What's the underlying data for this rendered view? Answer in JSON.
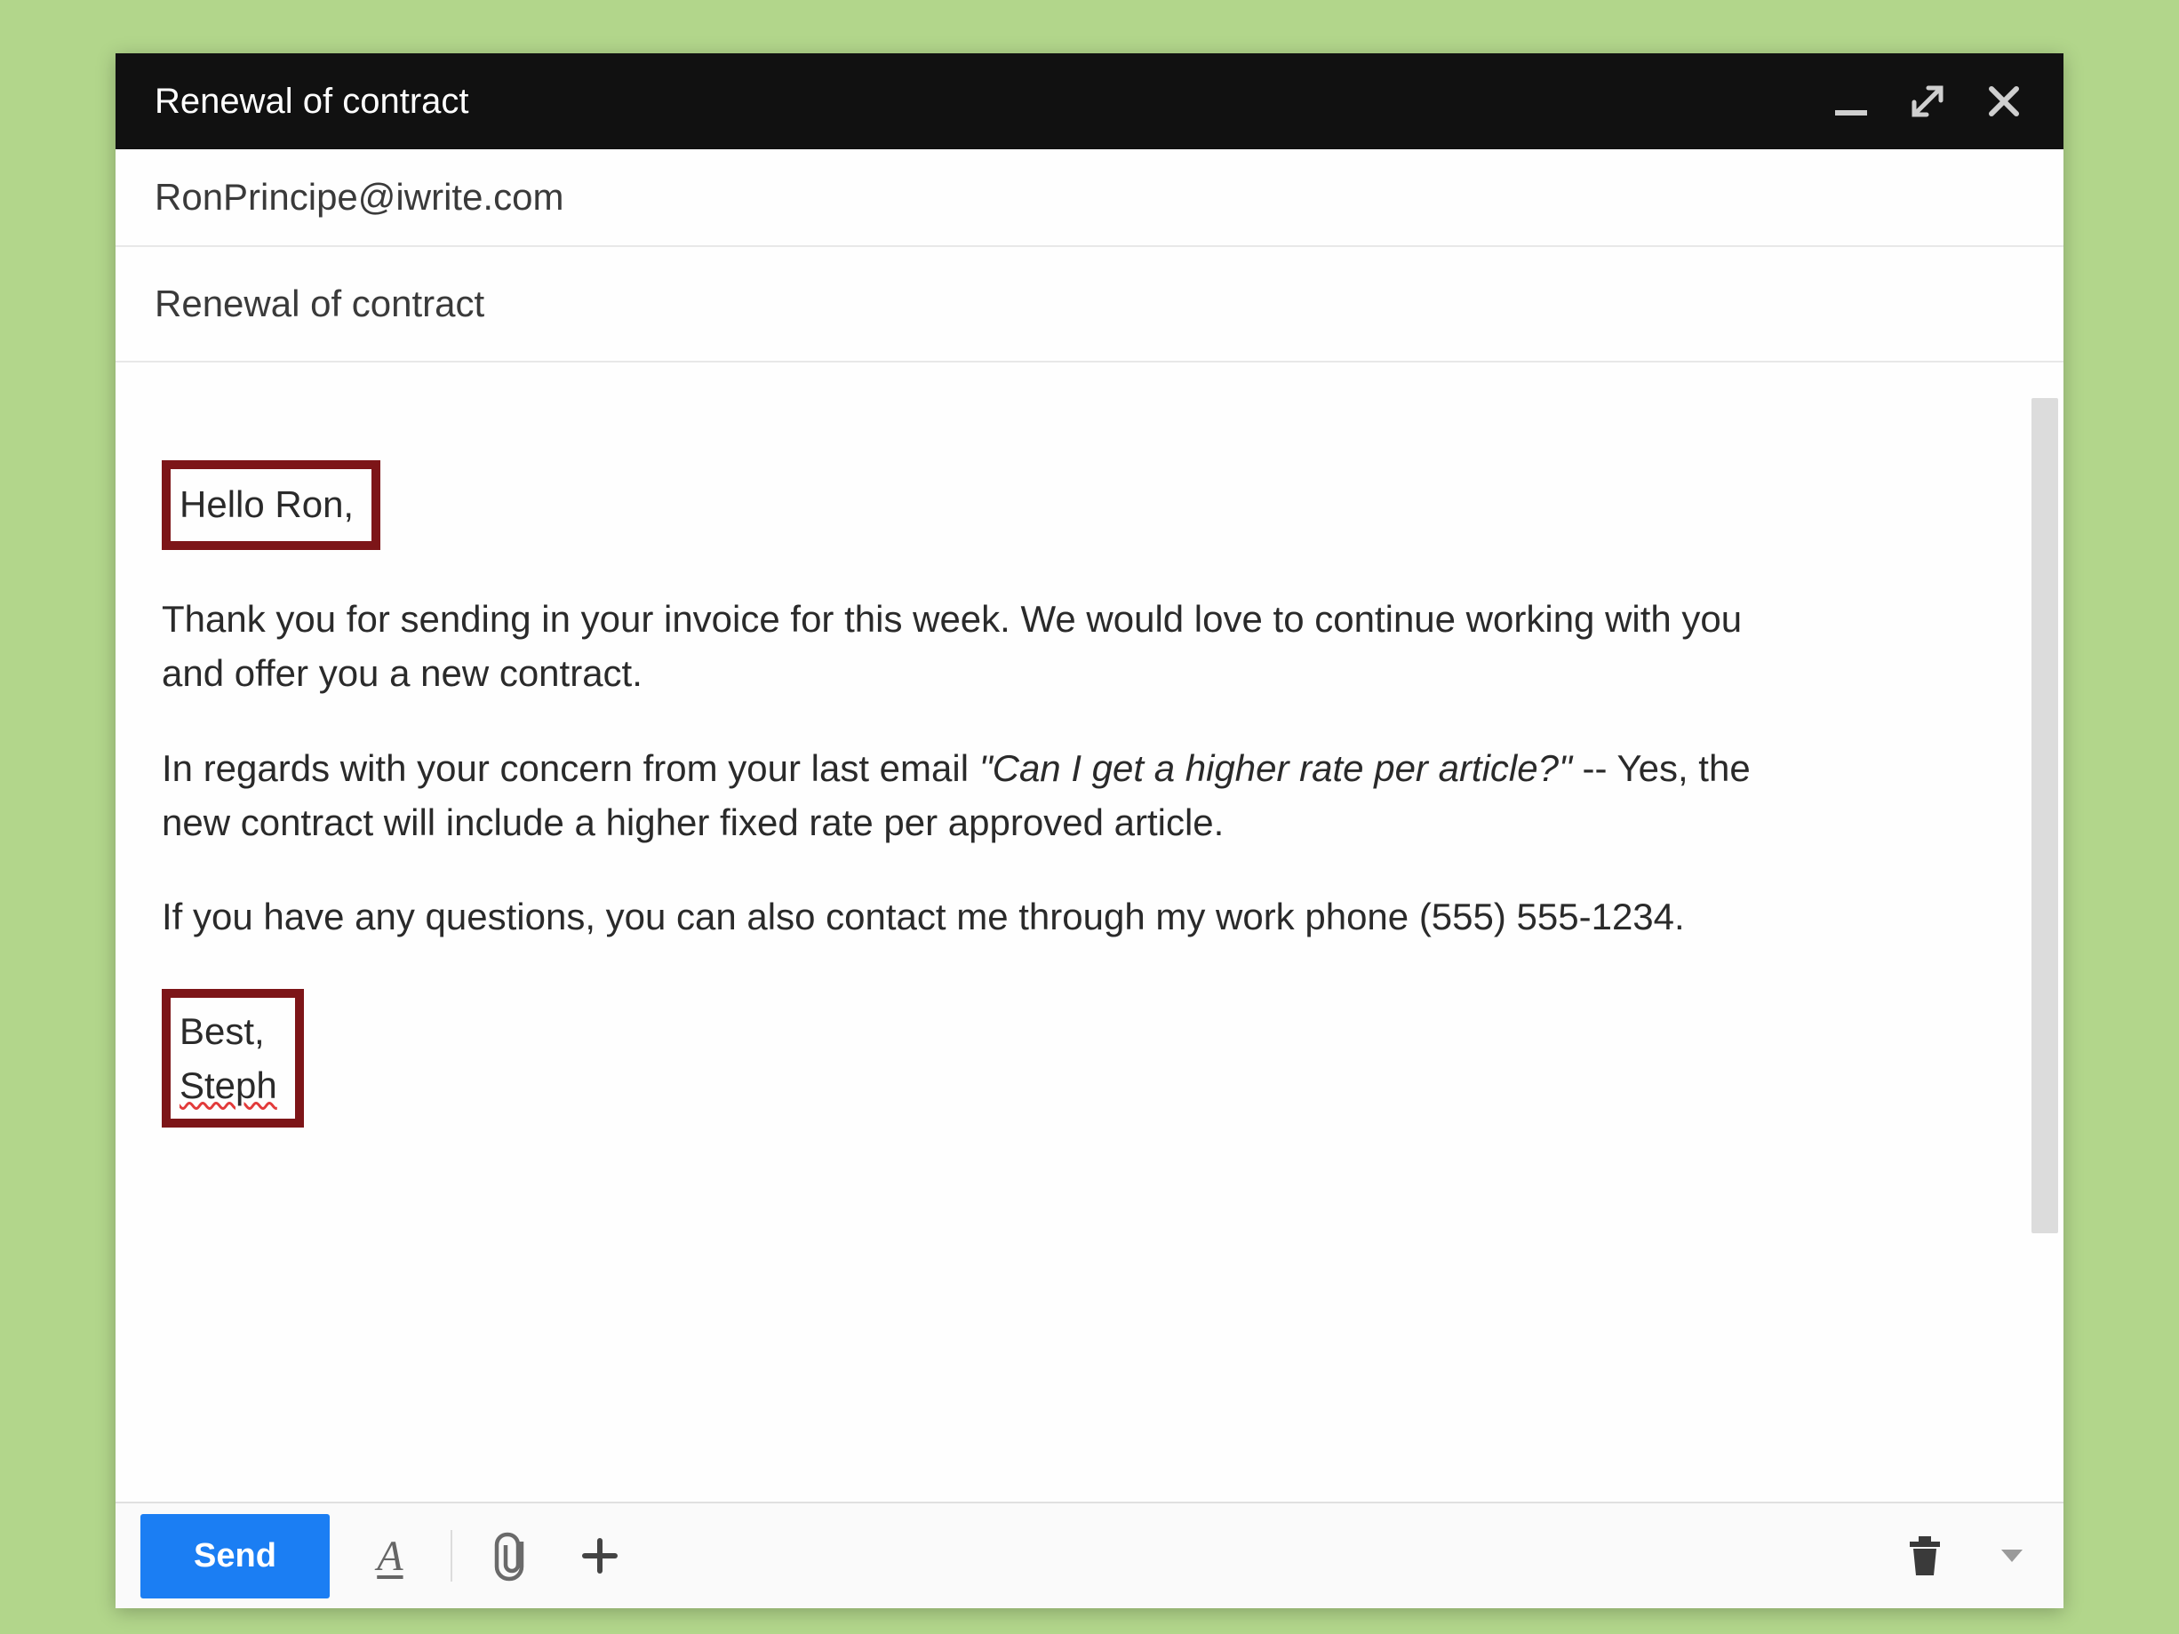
{
  "header": {
    "subject_title": "Renewal of contract"
  },
  "fields": {
    "to": "RonPrincipe@iwrite.com",
    "subject": "Renewal of contract"
  },
  "body": {
    "greeting": "Hello Ron,",
    "para1": "Thank you for sending in your invoice for this week. We would love to continue working with you and offer you a new contract.",
    "para2_prefix": "In regards with your concern from your last email ",
    "para2_quote": "\"Can I get a higher rate per article?\"",
    "para2_suffix": " -- Yes, the new contract will include a higher fixed rate per approved article.",
    "para3": "If you have any questions, you can also contact me through my work phone (555) 555-1234.",
    "closing_line1": "Best,",
    "closing_line2": "Steph"
  },
  "toolbar": {
    "send_label": "Send"
  },
  "icons": {
    "minimize": "minimize",
    "expand": "expand",
    "close": "close",
    "format": "A",
    "attach": "attach",
    "add": "add",
    "trash": "trash",
    "more": "more"
  }
}
